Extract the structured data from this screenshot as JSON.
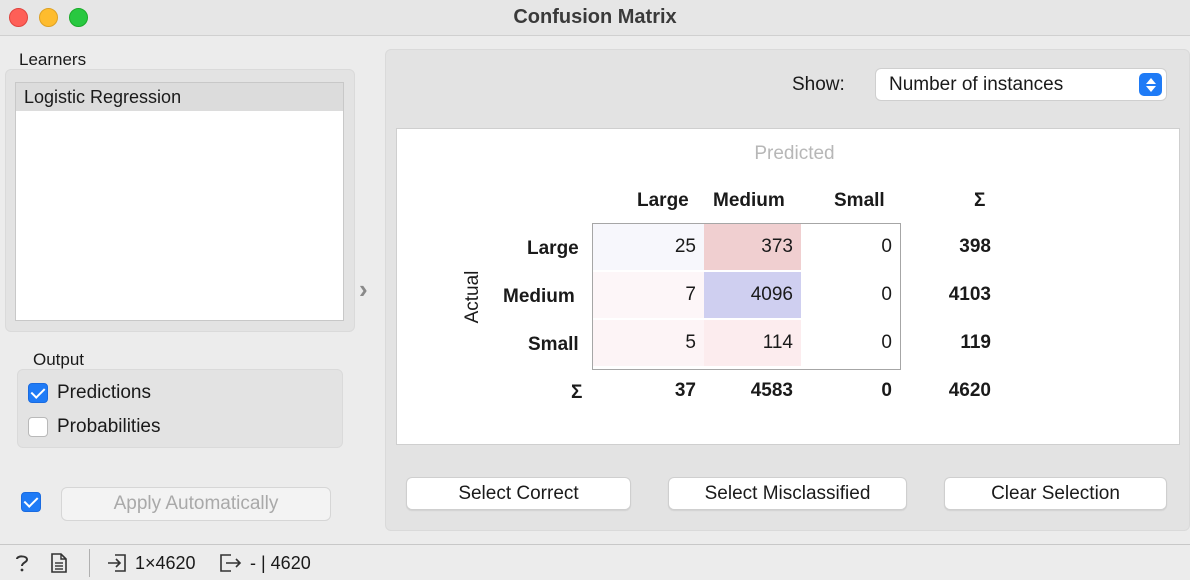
{
  "window": {
    "title": "Confusion Matrix"
  },
  "learners": {
    "label": "Learners",
    "items": [
      "Logistic Regression"
    ]
  },
  "output": {
    "label": "Output",
    "predictions": {
      "label": "Predictions",
      "checked": true
    },
    "probabilities": {
      "label": "Probabilities",
      "checked": false
    }
  },
  "apply": {
    "label": "Apply Automatically",
    "checked": true
  },
  "show": {
    "label": "Show:",
    "value": "Number of instances"
  },
  "matrix": {
    "predicted_label": "Predicted",
    "actual_label": "Actual",
    "sum_symbol": "Σ",
    "columns": [
      "Large",
      "Medium",
      "Small"
    ],
    "rows": [
      {
        "label": "Large",
        "values": [
          "25",
          "373",
          "0"
        ],
        "sum": "398"
      },
      {
        "label": "Medium",
        "values": [
          "7",
          "4096",
          "0"
        ],
        "sum": "4103"
      },
      {
        "label": "Small",
        "values": [
          "5",
          "114",
          "0"
        ],
        "sum": "119"
      }
    ],
    "column_sums": [
      "37",
      "4583",
      "0"
    ],
    "total": "4620",
    "cell_colors": [
      [
        "#f7f7fc",
        "#f0cfd0",
        "#ffffff"
      ],
      [
        "#fdf6f8",
        "#cfcff0",
        "#ffffff"
      ],
      [
        "#fdf4f6",
        "#fcecee",
        "#ffffff"
      ]
    ]
  },
  "buttons": {
    "select_correct": "Select Correct",
    "select_misclassified": "Select Misclassified",
    "clear_selection": "Clear Selection"
  },
  "status": {
    "input_summary": "1×4620",
    "output_summary": "- | 4620"
  }
}
